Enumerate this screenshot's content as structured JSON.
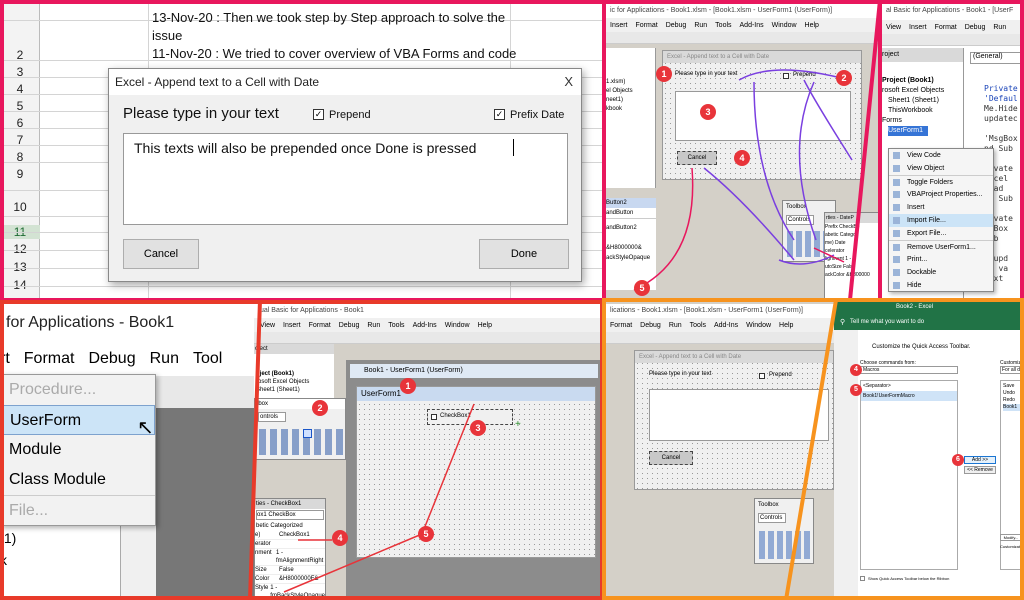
{
  "excel_panel": {
    "rows": [
      "",
      "2",
      "3",
      "4",
      "5",
      "6",
      "7",
      "8",
      "9",
      "10",
      "11",
      "12",
      "13",
      "14"
    ],
    "notes": [
      "13-Nov-20 :  Then we took step by Step approach to solve the",
      "issue",
      "11-Nov-20 :  We tried to cover overview of VBA Forms and code"
    ],
    "dialog": {
      "title": "Excel - Append text to a Cell with Date",
      "close": "X",
      "prompt": "Please type in your text",
      "prepend_label": "Prepend",
      "prefix_label": "Prefix Date",
      "text_value": "This texts will also be prepended  once Done is pressed",
      "cancel_label": "Cancel",
      "done_label": "Done"
    }
  },
  "designer_panel": {
    "title": "ic for Applications - Book1.xlsm - [Book1.xlsm - UserForm1 (UserForm)]",
    "menu": [
      "Insert",
      "Format",
      "Debug",
      "Run",
      "Tools",
      "Add-Ins",
      "Window",
      "Help"
    ],
    "form_title": "Excel - Append text to a Cell with Date",
    "prompt": "Please type in your text",
    "prepend_label": "Prepend",
    "cancel_label": "Cancel",
    "left_items": [
      "1.xlsm)",
      "el Objects",
      "neet1)",
      "kbook"
    ],
    "props_title": "Button2",
    "props_sub": "andButton",
    "props_rows": [
      "andButton2",
      "&H8000000&",
      "ackStyleOpaque"
    ],
    "toolbox_title": "Toolbox",
    "toolbox_tab": "Controls",
    "props2_title": "rties - DateP",
    "props2_rows": [
      "Prefix CheckBo",
      "abetic  Catego",
      "me)  Date",
      "celerator",
      "lignment  1 - f",
      "utoSize  False",
      "ackColor  &H800000"
    ],
    "badges": [
      "1",
      "2",
      "3",
      "4",
      "5"
    ]
  },
  "project_panel": {
    "title": "al Basic for Applications - Book1 - [UserF",
    "menu": [
      "View",
      "Insert",
      "Format",
      "Debug",
      "Run"
    ],
    "explorer_title": "roject",
    "tree": [
      "Project (Book1)",
      "rosoft Excel Objects",
      "Sheet1 (Sheet1)",
      "ThisWorkbook",
      "Forms",
      "UserForm1"
    ],
    "combo": "(General)",
    "code_lines": [
      "Private",
      "'Defaul",
      "Me.Hide",
      "updatec",
      "",
      "'MsgBox",
      "nd Sub",
      "",
      "rivate",
      "ancel",
      "load",
      "nd Sub",
      "",
      "rivate",
      "xtBox",
      " Lab",
      "",
      "b upd",
      "et va",
      "text"
    ],
    "context_menu": [
      "View Code",
      "View Object",
      "Toggle Folders",
      "VBAProject Properties...",
      "Insert",
      "Import File...",
      "Export File...",
      "Remove UserForm1...",
      "Print...",
      "Dockable",
      "Hide"
    ]
  },
  "insert_panel": {
    "title": "for Applications - Book1",
    "menu": [
      "rt",
      "Format",
      "Debug",
      "Run",
      "Tool"
    ],
    "items": [
      "Procedure...",
      "UserForm",
      "Module",
      "Class Module",
      "File..."
    ],
    "bottom_text": "t1)",
    "bottom_text2": "k"
  },
  "checkbox_panel": {
    "title": "ual Basic for Applications - Book1",
    "menu": [
      "View",
      "Insert",
      "Format",
      "Debug",
      "Run",
      "Tools",
      "Add-Ins",
      "Window",
      "Help"
    ],
    "window_title": "Book1 - UserForm1 (UserForm)",
    "form_name": "UserForm1",
    "checkbox_label": "CheckBox1",
    "explorer_title": "oject",
    "tree": [
      "oject (Book1)",
      "rosoft Excel Objects",
      "Sheet1 (Sheet1)"
    ],
    "toolbox_title": "lbox",
    "toolbox_tab": "ontrols",
    "props_title": "ties - CheckBox1",
    "props_combo": "ox1  CheckBox",
    "props_tabs": "betic  Categorized",
    "props_rows": [
      [
        "e)",
        "CheckBox1"
      ],
      [
        "erator",
        ""
      ],
      [
        "nment",
        "1 - fmAlignmentRight"
      ],
      [
        "Size",
        "False"
      ],
      [
        "Color",
        "&H8000000F&"
      ],
      [
        "Style",
        "1 - fmBackStyleOpaque"
      ],
      [
        "ption",
        "CheckBox1"
      ]
    ],
    "badges": [
      "1",
      "2",
      "3",
      "4",
      "5"
    ]
  },
  "form2_panel": {
    "title": "lications - Book1.xlsm - [Book1.xlsm - UserForm1 (UserForm)]",
    "menu": [
      "Format",
      "Debug",
      "Run",
      "Tools",
      "Add-Ins",
      "Window",
      "Help"
    ],
    "form_title": "Excel - Append text to a Cell with Date",
    "prompt": "Please type in your text",
    "prepend_label": "Prepend",
    "cancel_label": "Cancel",
    "toolbox_title": "Toolbox",
    "toolbox_tab": "Controls"
  },
  "qat_panel": {
    "title": "Book2 - Excel",
    "tell_me": "Tell me what you want to do",
    "heading": "Customize the Quick Access Toolbar.",
    "choose_label": "Choose commands from:",
    "choose_value": "Macros",
    "list_items": [
      "<Separator>",
      "Book1!UserFormMacro"
    ],
    "right_label": "Customize",
    "right_value": "For all do",
    "right_items": [
      "Save",
      "Undo",
      "Redo",
      "Book1"
    ],
    "add_label": "Add >>",
    "remove_label": "<< Remove",
    "modify_label": "Modify...",
    "customizations": "Customizati",
    "show_below": "Show Quick Access Toolbar below the Ribbon",
    "badges": [
      "4",
      "5",
      "6"
    ]
  }
}
